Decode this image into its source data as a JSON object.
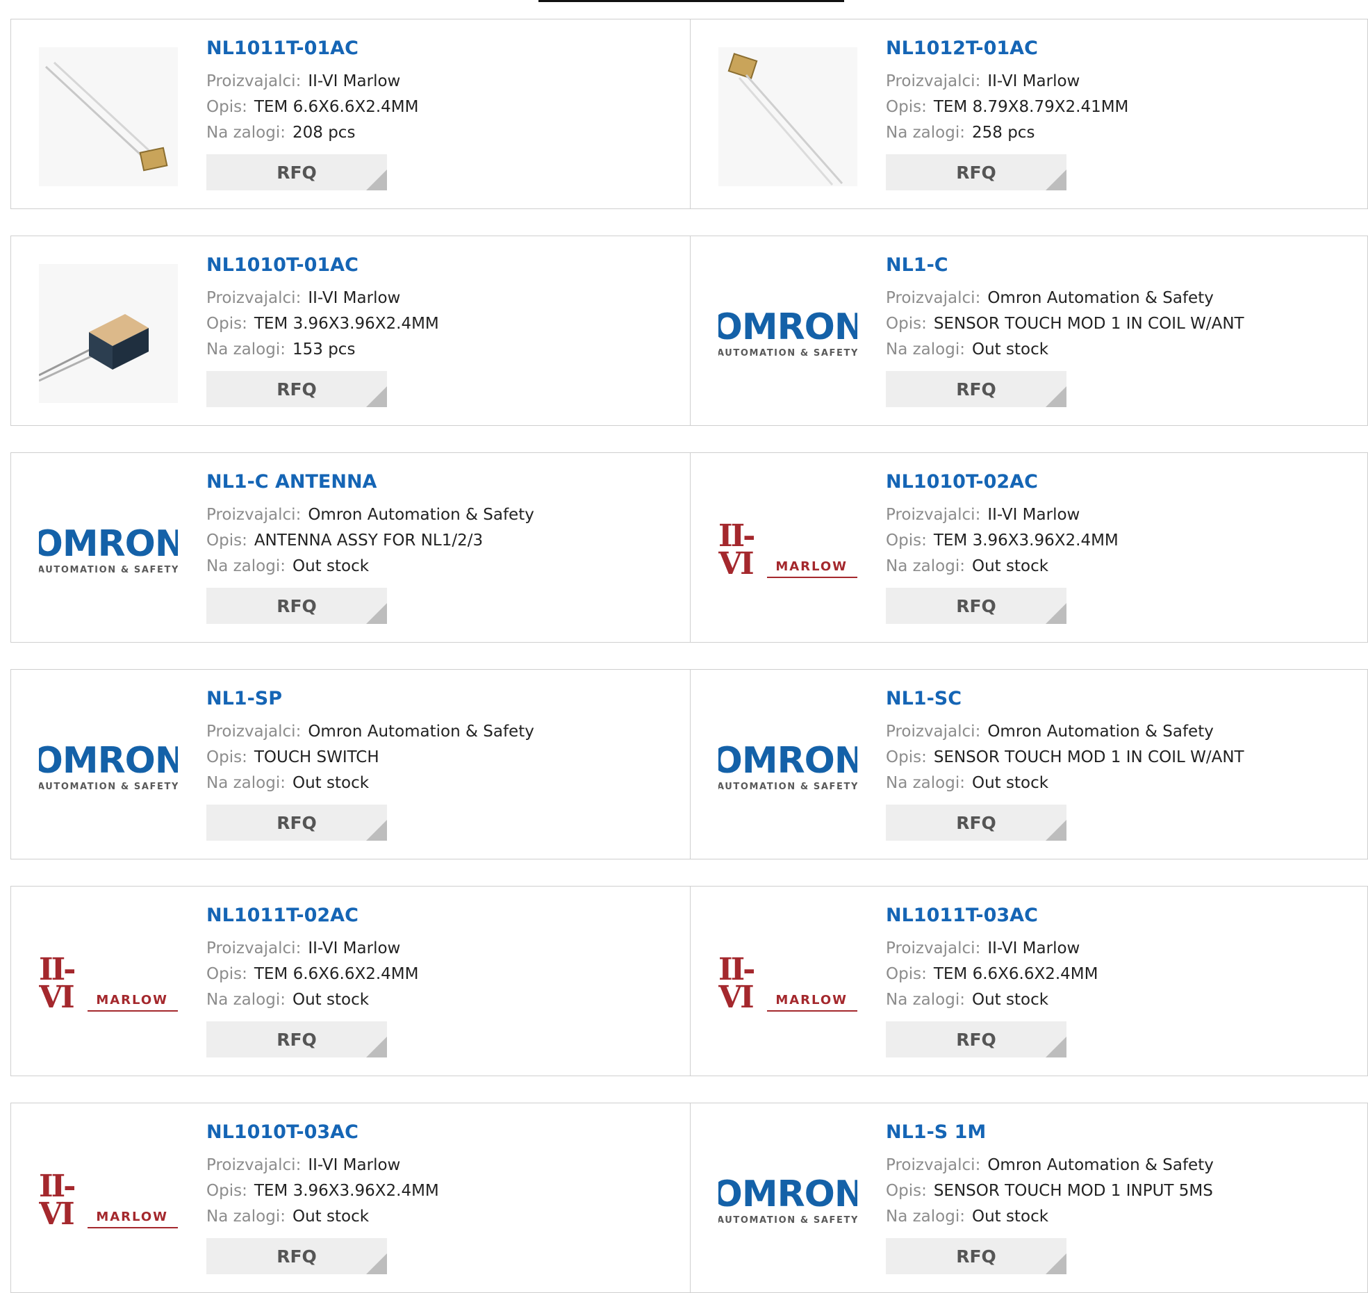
{
  "labels": {
    "manufacturer": "Proizvajalci:",
    "description": "Opis:",
    "stock": "Na zalogi:",
    "rfq": "RFQ"
  },
  "logos": {
    "omron_word": "OMRON",
    "omron_sub": "AUTOMATION & SAFETY",
    "marlow_iivi": "II-VI",
    "marlow_word": "MARLOW"
  },
  "colors": {
    "link": "#1565b5",
    "label": "#8c8c8c",
    "omron": "#1461a8",
    "marlow": "#a4282d",
    "button": "#eeeeee"
  },
  "products": [
    {
      "pn": "NL1011T-01AC",
      "manufacturer": "II-VI Marlow",
      "description": "TEM 6.6X6.6X2.4MM",
      "stock": "208 pcs",
      "image": "photo-wire-cell"
    },
    {
      "pn": "NL1012T-01AC",
      "manufacturer": "II-VI Marlow",
      "description": "TEM 8.79X8.79X2.41MM",
      "stock": "258 pcs",
      "image": "photo-wire-cell-2"
    },
    {
      "pn": "NL1010T-01AC",
      "manufacturer": "II-VI Marlow",
      "description": "TEM 3.96X3.96X2.4MM",
      "stock": "153 pcs",
      "image": "photo-peltier-module"
    },
    {
      "pn": "NL1-C",
      "manufacturer": "Omron Automation & Safety",
      "description": "SENSOR TOUCH MOD 1 IN COIL W/ANT",
      "stock": "Out stock",
      "image": "omron-logo"
    },
    {
      "pn": "NL1-C ANTENNA",
      "manufacturer": "Omron Automation & Safety",
      "description": "ANTENNA ASSY FOR NL1/2/3",
      "stock": "Out stock",
      "image": "omron-logo"
    },
    {
      "pn": "NL1010T-02AC",
      "manufacturer": "II-VI Marlow",
      "description": "TEM 3.96X3.96X2.4MM",
      "stock": "Out stock",
      "image": "marlow-logo"
    },
    {
      "pn": "NL1-SP",
      "manufacturer": "Omron Automation & Safety",
      "description": "TOUCH SWITCH",
      "stock": "Out stock",
      "image": "omron-logo"
    },
    {
      "pn": "NL1-SC",
      "manufacturer": "Omron Automation & Safety",
      "description": "SENSOR TOUCH MOD 1 IN COIL W/ANT",
      "stock": "Out stock",
      "image": "omron-logo"
    },
    {
      "pn": "NL1011T-02AC",
      "manufacturer": "II-VI Marlow",
      "description": "TEM 6.6X6.6X2.4MM",
      "stock": "Out stock",
      "image": "marlow-logo"
    },
    {
      "pn": "NL1011T-03AC",
      "manufacturer": "II-VI Marlow",
      "description": "TEM 6.6X6.6X2.4MM",
      "stock": "Out stock",
      "image": "marlow-logo"
    },
    {
      "pn": "NL1010T-03AC",
      "manufacturer": "II-VI Marlow",
      "description": "TEM 3.96X3.96X2.4MM",
      "stock": "Out stock",
      "image": "marlow-logo"
    },
    {
      "pn": "NL1-S 1M",
      "manufacturer": "Omron Automation & Safety",
      "description": "SENSOR TOUCH MOD 1 INPUT 5MS",
      "stock": "Out stock",
      "image": "omron-logo"
    }
  ]
}
